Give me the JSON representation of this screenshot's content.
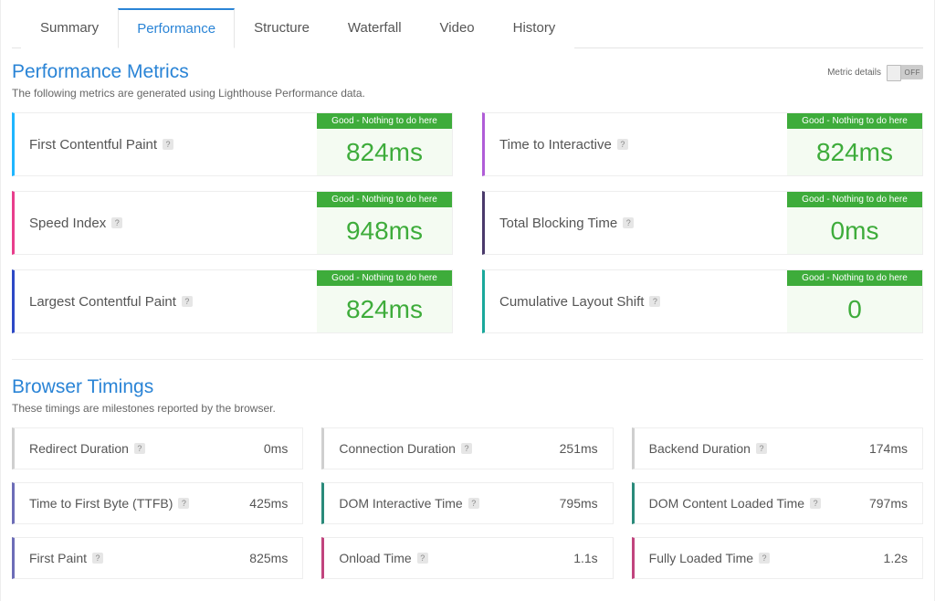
{
  "tabs": [
    {
      "label": "Summary"
    },
    {
      "label": "Performance"
    },
    {
      "label": "Structure"
    },
    {
      "label": "Waterfall"
    },
    {
      "label": "Video"
    },
    {
      "label": "History"
    }
  ],
  "active_tab_index": 1,
  "perf": {
    "title": "Performance Metrics",
    "subtitle": "The following metrics are generated using Lighthouse Performance data.",
    "toggle_label": "Metric details",
    "toggle_state": "OFF",
    "good_status": "Good - Nothing to do here",
    "cards": [
      {
        "label": "First Contentful Paint",
        "value": "824ms",
        "accent": "#1fb6ff"
      },
      {
        "label": "Time to Interactive",
        "value": "824ms",
        "accent": "#b05dd7"
      },
      {
        "label": "Speed Index",
        "value": "948ms",
        "accent": "#e83e8c"
      },
      {
        "label": "Total Blocking Time",
        "value": "0ms",
        "accent": "#4a3a6b"
      },
      {
        "label": "Largest Contentful Paint",
        "value": "824ms",
        "accent": "#2d49c6"
      },
      {
        "label": "Cumulative Layout Shift",
        "value": "0",
        "accent": "#1aa89b"
      }
    ]
  },
  "timings": {
    "title": "Browser Timings",
    "subtitle": "These timings are milestones reported by the browser.",
    "cards": [
      {
        "label": "Redirect Duration",
        "value": "0ms",
        "accent": "#cfcfcf"
      },
      {
        "label": "Connection Duration",
        "value": "251ms",
        "accent": "#cfcfcf"
      },
      {
        "label": "Backend Duration",
        "value": "174ms",
        "accent": "#cfcfcf"
      },
      {
        "label": "Time to First Byte (TTFB)",
        "value": "425ms",
        "accent": "#6d6db7"
      },
      {
        "label": "DOM Interactive Time",
        "value": "795ms",
        "accent": "#2a8a7a"
      },
      {
        "label": "DOM Content Loaded Time",
        "value": "797ms",
        "accent": "#2a8a7a"
      },
      {
        "label": "First Paint",
        "value": "825ms",
        "accent": "#6d6db7"
      },
      {
        "label": "Onload Time",
        "value": "1.1s",
        "accent": "#c1447e"
      },
      {
        "label": "Fully Loaded Time",
        "value": "1.2s",
        "accent": "#c1447e"
      }
    ]
  }
}
